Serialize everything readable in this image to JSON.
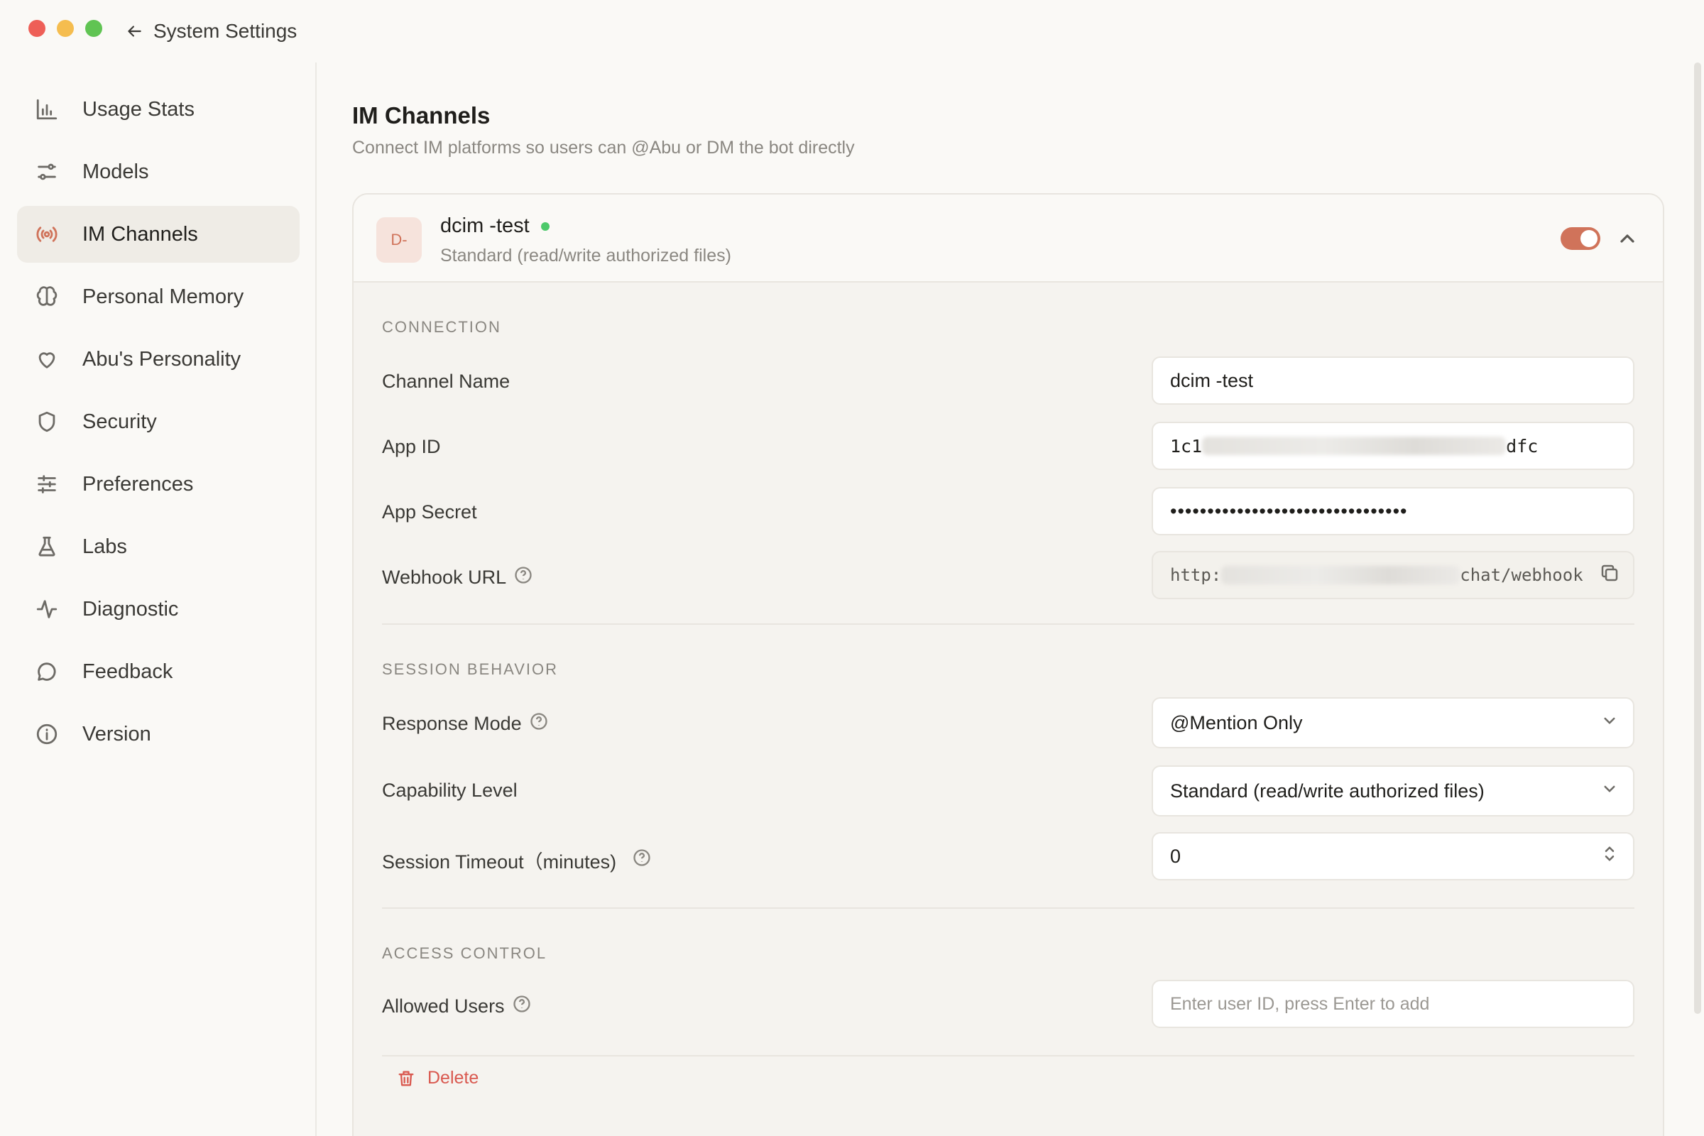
{
  "window": {
    "back_label": "System Settings"
  },
  "sidebar": {
    "items": [
      {
        "label": "Usage Stats",
        "icon": "bar-chart-icon"
      },
      {
        "label": "Models",
        "icon": "sliders-icon"
      },
      {
        "label": "IM Channels",
        "icon": "broadcast-icon",
        "active": true
      },
      {
        "label": "Personal Memory",
        "icon": "brain-icon"
      },
      {
        "label": "Abu's Personality",
        "icon": "heart-icon"
      },
      {
        "label": "Security",
        "icon": "shield-icon"
      },
      {
        "label": "Preferences",
        "icon": "settings-sliders-icon"
      },
      {
        "label": "Labs",
        "icon": "flask-icon"
      },
      {
        "label": "Diagnostic",
        "icon": "pulse-icon"
      },
      {
        "label": "Feedback",
        "icon": "chat-bubble-icon"
      },
      {
        "label": "Version",
        "icon": "info-icon"
      }
    ]
  },
  "main": {
    "title": "IM Channels",
    "subtitle": "Connect IM platforms so users can @Abu or DM the bot directly",
    "channel": {
      "avatar_text": "D-",
      "name": "dcim -test",
      "description": "Standard (read/write authorized files)",
      "enabled": true,
      "accent_color": "#d0735a",
      "status_color": "#4cc96a"
    },
    "connection": {
      "section_label": "CONNECTION",
      "channel_name_label": "Channel Name",
      "channel_name_value": "dcim -test",
      "app_id_label": "App ID",
      "app_id_prefix": "1c1",
      "app_id_suffix": "dfc",
      "app_secret_label": "App Secret",
      "app_secret_value": "••••••••••••••••••••••••••••••••",
      "webhook_label": "Webhook URL",
      "webhook_prefix": "http:",
      "webhook_suffix": "chat/webhook"
    },
    "session": {
      "section_label": "SESSION BEHAVIOR",
      "response_mode_label": "Response Mode",
      "response_mode_value": "@Mention Only",
      "capability_label": "Capability Level",
      "capability_value": "Standard (read/write authorized files)",
      "timeout_label": "Session Timeout（minutes)",
      "timeout_value": "0"
    },
    "access": {
      "section_label": "ACCESS CONTROL",
      "allowed_users_label": "Allowed Users",
      "allowed_users_placeholder": "Enter user ID, press Enter to add"
    },
    "delete_label": "Delete"
  }
}
